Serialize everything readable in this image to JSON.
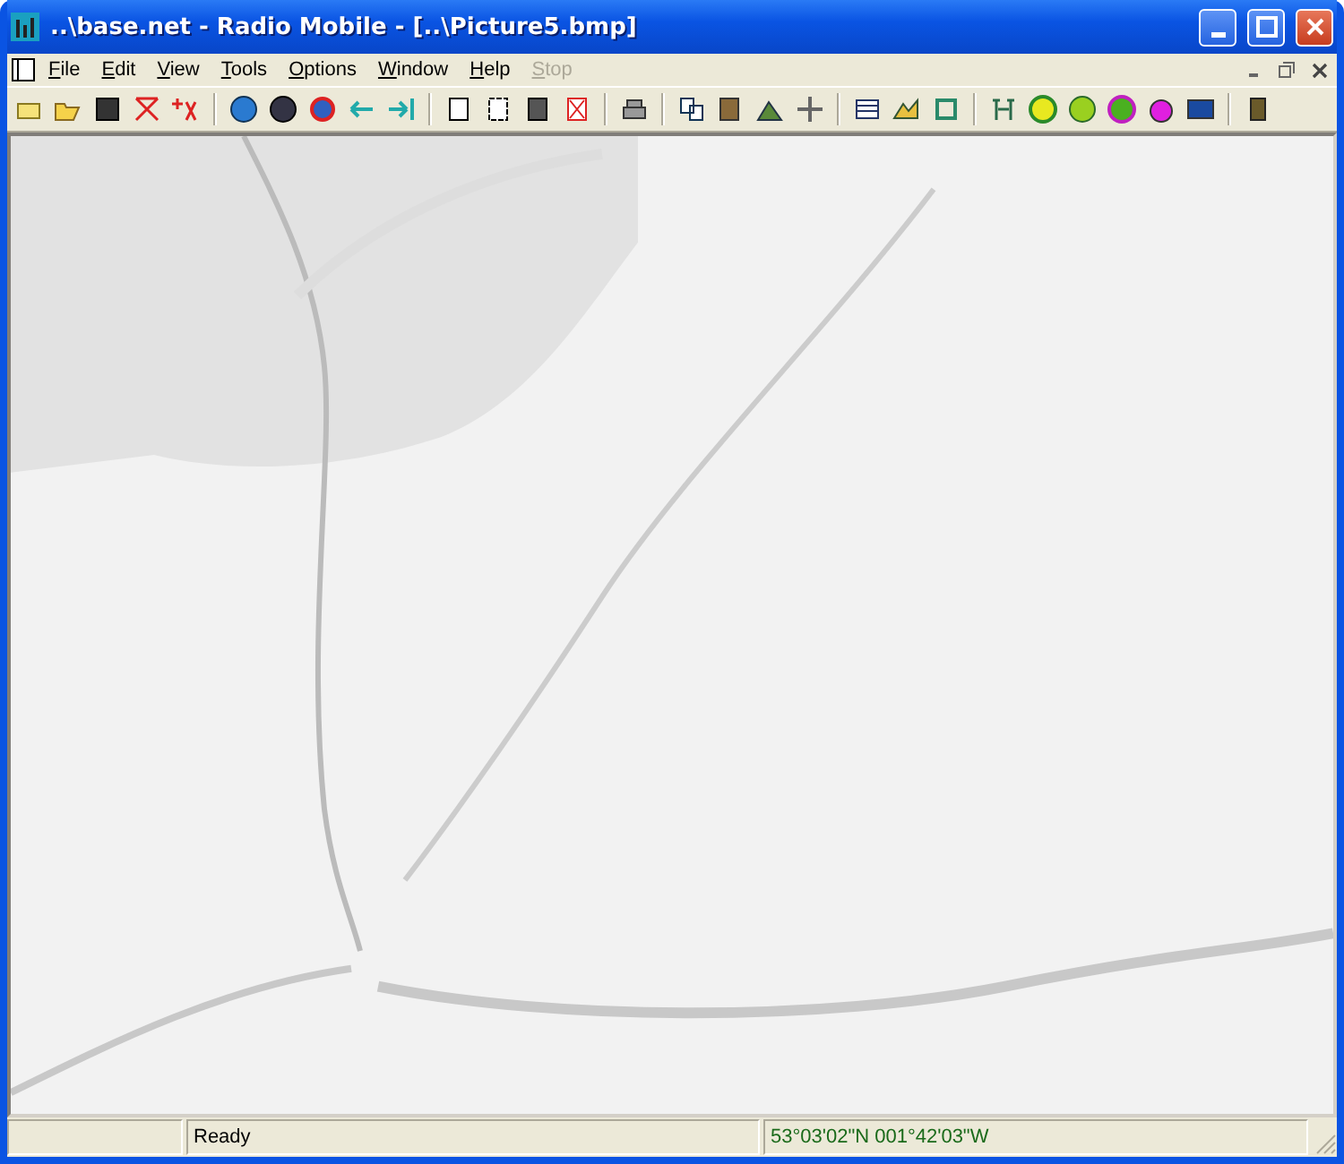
{
  "window": {
    "title": "..\\base.net - Radio Mobile - [..\\Picture5.bmp]"
  },
  "menu": [
    {
      "label": "File",
      "disabled": false
    },
    {
      "label": "Edit",
      "disabled": false
    },
    {
      "label": "View",
      "disabled": false
    },
    {
      "label": "Tools",
      "disabled": false
    },
    {
      "label": "Options",
      "disabled": false
    },
    {
      "label": "Window",
      "disabled": false
    },
    {
      "label": "Help",
      "disabled": false
    },
    {
      "label": "Stop",
      "disabled": true
    }
  ],
  "status_bar": {
    "message": "Ready",
    "coordinates": "53°03'02\"N 001°42'03\"W"
  }
}
